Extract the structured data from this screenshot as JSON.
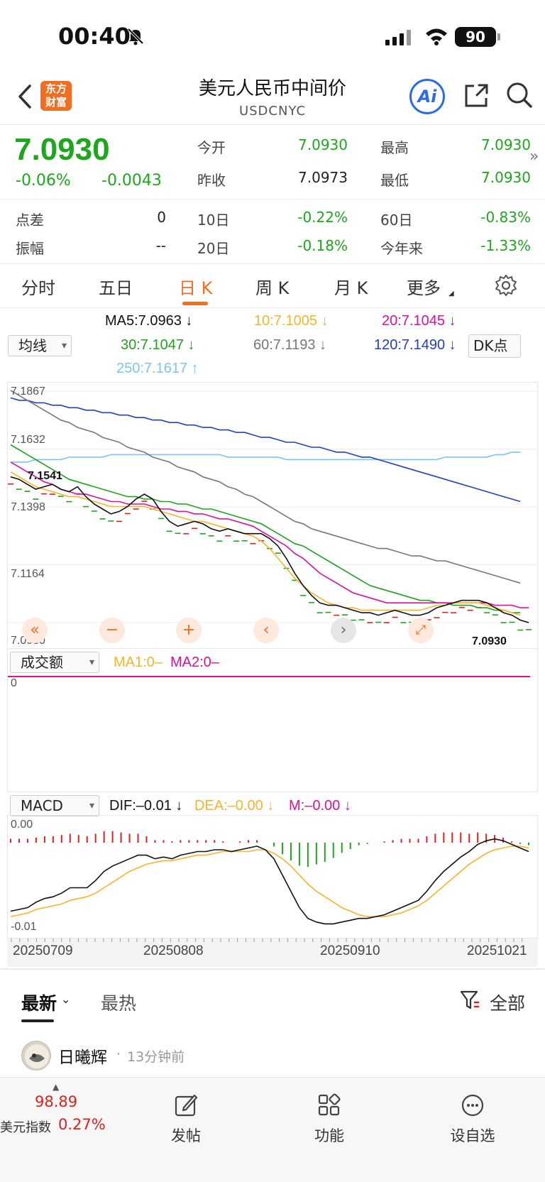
{
  "status": {
    "time": "00:40",
    "battery": "90"
  },
  "nav": {
    "logo_line1": "东方",
    "logo_line2": "财富",
    "title": "美元人民币中间价",
    "subtitle": "USDCNYC",
    "ai_label": "Ai"
  },
  "quote": {
    "price": "7.0930",
    "change_pct": "-0.06%",
    "change": "-0.0043",
    "open_label": "今开",
    "open": "7.0930",
    "high_label": "最高",
    "high": "7.0930",
    "prev_label": "昨收",
    "prev": "7.0973",
    "low_label": "最低",
    "low": "7.0930",
    "spread_label": "点差",
    "spread": "0",
    "d10_label": "10日",
    "d10": "-0.22%",
    "d60_label": "60日",
    "d60": "-0.83%",
    "amp_label": "振幅",
    "amp": "--",
    "d20_label": "20日",
    "d20": "-0.18%",
    "ytd_label": "今年来",
    "ytd": "-1.33%"
  },
  "tabs": [
    "分时",
    "五日",
    "日 K",
    "周 K",
    "月 K",
    "更多"
  ],
  "active_tab": "日 K",
  "ma": {
    "selector": "均线",
    "ma5": "MA5:7.0963 ↓",
    "ma10": "10:7.1005 ↓",
    "ma20": "20:7.1045 ↓",
    "ma30": "30:7.1047 ↓",
    "ma60": "60:7.1193 ↓",
    "ma120": "120:7.1490 ↓",
    "ma250": "250:7.1617 ↑",
    "dk": "DK点"
  },
  "colors": {
    "ma5": "#111111",
    "ma10": "#f5b52e",
    "ma20": "#e0109a",
    "ma30": "#22a022",
    "ma60": "#777777",
    "ma120": "#2440c0",
    "ma250": "#7cc4f4",
    "accent": "#f36d21",
    "up": "#e02020",
    "down": "#1ea61e"
  },
  "price_axis": {
    "ticks": [
      "7.1867",
      "7.1632",
      "7.1398",
      "7.1164",
      "7.0930"
    ],
    "max_mark": "7.1541",
    "last_mark": "7.0930"
  },
  "volume": {
    "selector": "成交额",
    "ma1": "MA1:0–",
    "ma2": "MA2:0–",
    "zero": "0"
  },
  "macd": {
    "selector": "MACD",
    "dif": "DIF:–0.01 ↓",
    "dea": "DEA:–0.00 ↓",
    "m": "M:–0.00 ↓",
    "top": "0.00",
    "bottom": "-0.01"
  },
  "dates": [
    "20250709",
    "20250808",
    "20250910",
    "20251021"
  ],
  "feed": {
    "tab_latest": "最新",
    "tab_hot": "最热",
    "filter": "全部",
    "post_user": "日曦辉",
    "post_time": "13分钟前"
  },
  "bottom": {
    "index_value": "98.89",
    "index_name": "美元指数",
    "index_change": "0.27%",
    "post_label": "发帖",
    "func_label": "功能",
    "watch_label": "设自选"
  },
  "chart_data": {
    "type": "line",
    "title": "",
    "ylim": [
      7.093,
      7.1867
    ],
    "ma5": [
      7.152,
      7.151,
      7.149,
      7.147,
      7.148,
      7.149,
      7.147,
      7.146,
      7.148,
      7.144,
      7.141,
      7.139,
      7.137,
      7.138,
      7.14,
      7.143,
      7.145,
      7.143,
      7.138,
      7.134,
      7.132,
      7.133,
      7.134,
      7.133,
      7.131,
      7.13,
      7.131,
      7.13,
      7.129,
      7.129,
      7.129,
      7.127,
      7.124,
      7.119,
      7.113,
      7.108,
      7.104,
      7.101,
      7.1,
      7.1,
      7.099,
      7.098,
      7.097,
      7.097,
      7.096,
      7.097,
      7.098,
      7.097,
      7.096,
      7.096,
      7.097,
      7.099,
      7.1,
      7.101,
      7.102,
      7.102,
      7.102,
      7.101,
      7.099,
      7.097,
      7.096,
      7.094,
      7.093
    ],
    "ma10": [
      7.154,
      7.152,
      7.15,
      7.148,
      7.147,
      7.146,
      7.145,
      7.144,
      7.144,
      7.143,
      7.142,
      7.141,
      7.14,
      7.14,
      7.14,
      7.14,
      7.14,
      7.139,
      7.138,
      7.137,
      7.136,
      7.135,
      7.134,
      7.134,
      7.133,
      7.132,
      7.131,
      7.13,
      7.129,
      7.128,
      7.126,
      7.123,
      7.119,
      7.115,
      7.111,
      7.108,
      7.105,
      7.103,
      7.101,
      7.1,
      7.099,
      7.099,
      7.098,
      7.098,
      7.098,
      7.098,
      7.098,
      7.098,
      7.098,
      7.098,
      7.099,
      7.1,
      7.1,
      7.101,
      7.101,
      7.101,
      7.101,
      7.1,
      7.099,
      7.098,
      7.097,
      7.096
    ],
    "ma20": [
      7.158,
      7.156,
      7.154,
      7.152,
      7.15,
      7.149,
      7.147,
      7.146,
      7.145,
      7.145,
      7.144,
      7.143,
      7.142,
      7.142,
      7.141,
      7.141,
      7.141,
      7.14,
      7.139,
      7.139,
      7.138,
      7.138,
      7.137,
      7.137,
      7.136,
      7.135,
      7.135,
      7.134,
      7.133,
      7.132,
      7.13,
      7.128,
      7.126,
      7.124,
      7.121,
      7.119,
      7.116,
      7.113,
      7.111,
      7.109,
      7.107,
      7.105,
      7.104,
      7.103,
      7.102,
      7.101,
      7.101,
      7.101,
      7.101,
      7.101,
      7.101,
      7.101,
      7.101,
      7.101,
      7.101,
      7.101,
      7.101,
      7.101,
      7.1,
      7.1,
      7.1,
      7.099,
      7.099
    ],
    "ma30": [
      7.165,
      7.163,
      7.161,
      7.159,
      7.157,
      7.155,
      7.153,
      7.151,
      7.15,
      7.149,
      7.148,
      7.147,
      7.146,
      7.145,
      7.144,
      7.144,
      7.143,
      7.143,
      7.142,
      7.142,
      7.141,
      7.141,
      7.14,
      7.139,
      7.139,
      7.138,
      7.137,
      7.136,
      7.135,
      7.134,
      7.133,
      7.131,
      7.129,
      7.127,
      7.125,
      7.124,
      7.122,
      7.12,
      7.118,
      7.116,
      7.114,
      7.112,
      7.11,
      7.108,
      7.107,
      7.106,
      7.105,
      7.104,
      7.103,
      7.102,
      7.102,
      7.101,
      7.101,
      7.1,
      7.1,
      7.1,
      7.099,
      7.099,
      7.098,
      7.098,
      7.097,
      7.097
    ],
    "ma60": [
      7.187,
      7.185,
      7.183,
      7.181,
      7.179,
      7.177,
      7.175,
      7.174,
      7.172,
      7.171,
      7.17,
      7.168,
      7.167,
      7.166,
      7.164,
      7.163,
      7.162,
      7.16,
      7.159,
      7.158,
      7.156,
      7.155,
      7.154,
      7.152,
      7.151,
      7.15,
      7.148,
      7.147,
      7.145,
      7.144,
      7.142,
      7.14,
      7.138,
      7.136,
      7.134,
      7.133,
      7.131,
      7.13,
      7.129,
      7.128,
      7.127,
      7.126,
      7.125,
      7.124,
      7.123,
      7.123,
      7.122,
      7.121,
      7.12,
      7.12,
      7.119,
      7.118,
      7.118,
      7.117,
      7.116,
      7.115,
      7.114,
      7.113,
      7.112,
      7.111,
      7.11,
      7.109
    ],
    "ma120": [
      7.184,
      7.183,
      7.183,
      7.182,
      7.182,
      7.181,
      7.181,
      7.18,
      7.18,
      7.179,
      7.179,
      7.178,
      7.178,
      7.177,
      7.177,
      7.176,
      7.176,
      7.175,
      7.175,
      7.174,
      7.174,
      7.173,
      7.173,
      7.172,
      7.172,
      7.171,
      7.171,
      7.17,
      7.17,
      7.169,
      7.168,
      7.168,
      7.167,
      7.166,
      7.166,
      7.165,
      7.164,
      7.164,
      7.163,
      7.162,
      7.162,
      7.161,
      7.16,
      7.16,
      7.159,
      7.158,
      7.157,
      7.156,
      7.155,
      7.154,
      7.153,
      7.152,
      7.151,
      7.15,
      7.149,
      7.148,
      7.147,
      7.146,
      7.145,
      7.144,
      7.143,
      7.142
    ],
    "ma250": [
      7.158,
      7.158,
      7.158,
      7.159,
      7.159,
      7.159,
      7.159,
      7.16,
      7.16,
      7.16,
      7.16,
      7.16,
      7.161,
      7.161,
      7.161,
      7.161,
      7.161,
      7.161,
      7.161,
      7.161,
      7.161,
      7.161,
      7.161,
      7.161,
      7.161,
      7.161,
      7.16,
      7.16,
      7.16,
      7.16,
      7.16,
      7.16,
      7.16,
      7.159,
      7.159,
      7.159,
      7.159,
      7.159,
      7.159,
      7.159,
      7.159,
      7.159,
      7.159,
      7.159,
      7.159,
      7.159,
      7.159,
      7.159,
      7.159,
      7.159,
      7.159,
      7.159,
      7.16,
      7.16,
      7.16,
      7.16,
      7.16,
      7.16,
      7.161,
      7.161,
      7.162,
      7.162
    ],
    "macd_dif": [
      -0.0095,
      -0.0094,
      -0.0093,
      -0.009,
      -0.0088,
      -0.0087,
      -0.0085,
      -0.0082,
      -0.0082,
      -0.0082,
      -0.0078,
      -0.0073,
      -0.007,
      -0.0068,
      -0.0066,
      -0.0064,
      -0.0064,
      -0.0066,
      -0.0065,
      -0.0066,
      -0.0064,
      -0.0063,
      -0.0062,
      -0.0062,
      -0.0061,
      -0.0061,
      -0.0062,
      -0.0061,
      -0.006,
      -0.0059,
      -0.0061,
      -0.0066,
      -0.0075,
      -0.0084,
      -0.0093,
      -0.0099,
      -0.0101,
      -0.0102,
      -0.0102,
      -0.0101,
      -0.01,
      -0.0099,
      -0.0099,
      -0.0098,
      -0.0097,
      -0.0095,
      -0.0093,
      -0.0091,
      -0.0089,
      -0.0084,
      -0.0078,
      -0.0073,
      -0.0069,
      -0.0065,
      -0.0062,
      -0.0058,
      -0.0056,
      -0.0055,
      -0.0056,
      -0.0058,
      -0.006,
      -0.0062
    ],
    "macd_dea": [
      -0.0098,
      -0.0097,
      -0.0096,
      -0.0094,
      -0.0093,
      -0.0092,
      -0.0091,
      -0.0089,
      -0.0088,
      -0.0087,
      -0.0085,
      -0.0082,
      -0.0079,
      -0.0076,
      -0.0073,
      -0.0071,
      -0.0069,
      -0.0068,
      -0.0067,
      -0.0067,
      -0.0066,
      -0.0065,
      -0.0064,
      -0.0064,
      -0.0063,
      -0.0062,
      -0.0062,
      -0.0062,
      -0.0062,
      -0.0061,
      -0.0061,
      -0.0063,
      -0.0066,
      -0.007,
      -0.0075,
      -0.008,
      -0.0084,
      -0.0087,
      -0.009,
      -0.0093,
      -0.0095,
      -0.0097,
      -0.0098,
      -0.0098,
      -0.0098,
      -0.0097,
      -0.0096,
      -0.0094,
      -0.0092,
      -0.0089,
      -0.0085,
      -0.0081,
      -0.0077,
      -0.0073,
      -0.0069,
      -0.0066,
      -0.0063,
      -0.0061,
      -0.006,
      -0.0059,
      -0.0059,
      -0.006
    ]
  }
}
